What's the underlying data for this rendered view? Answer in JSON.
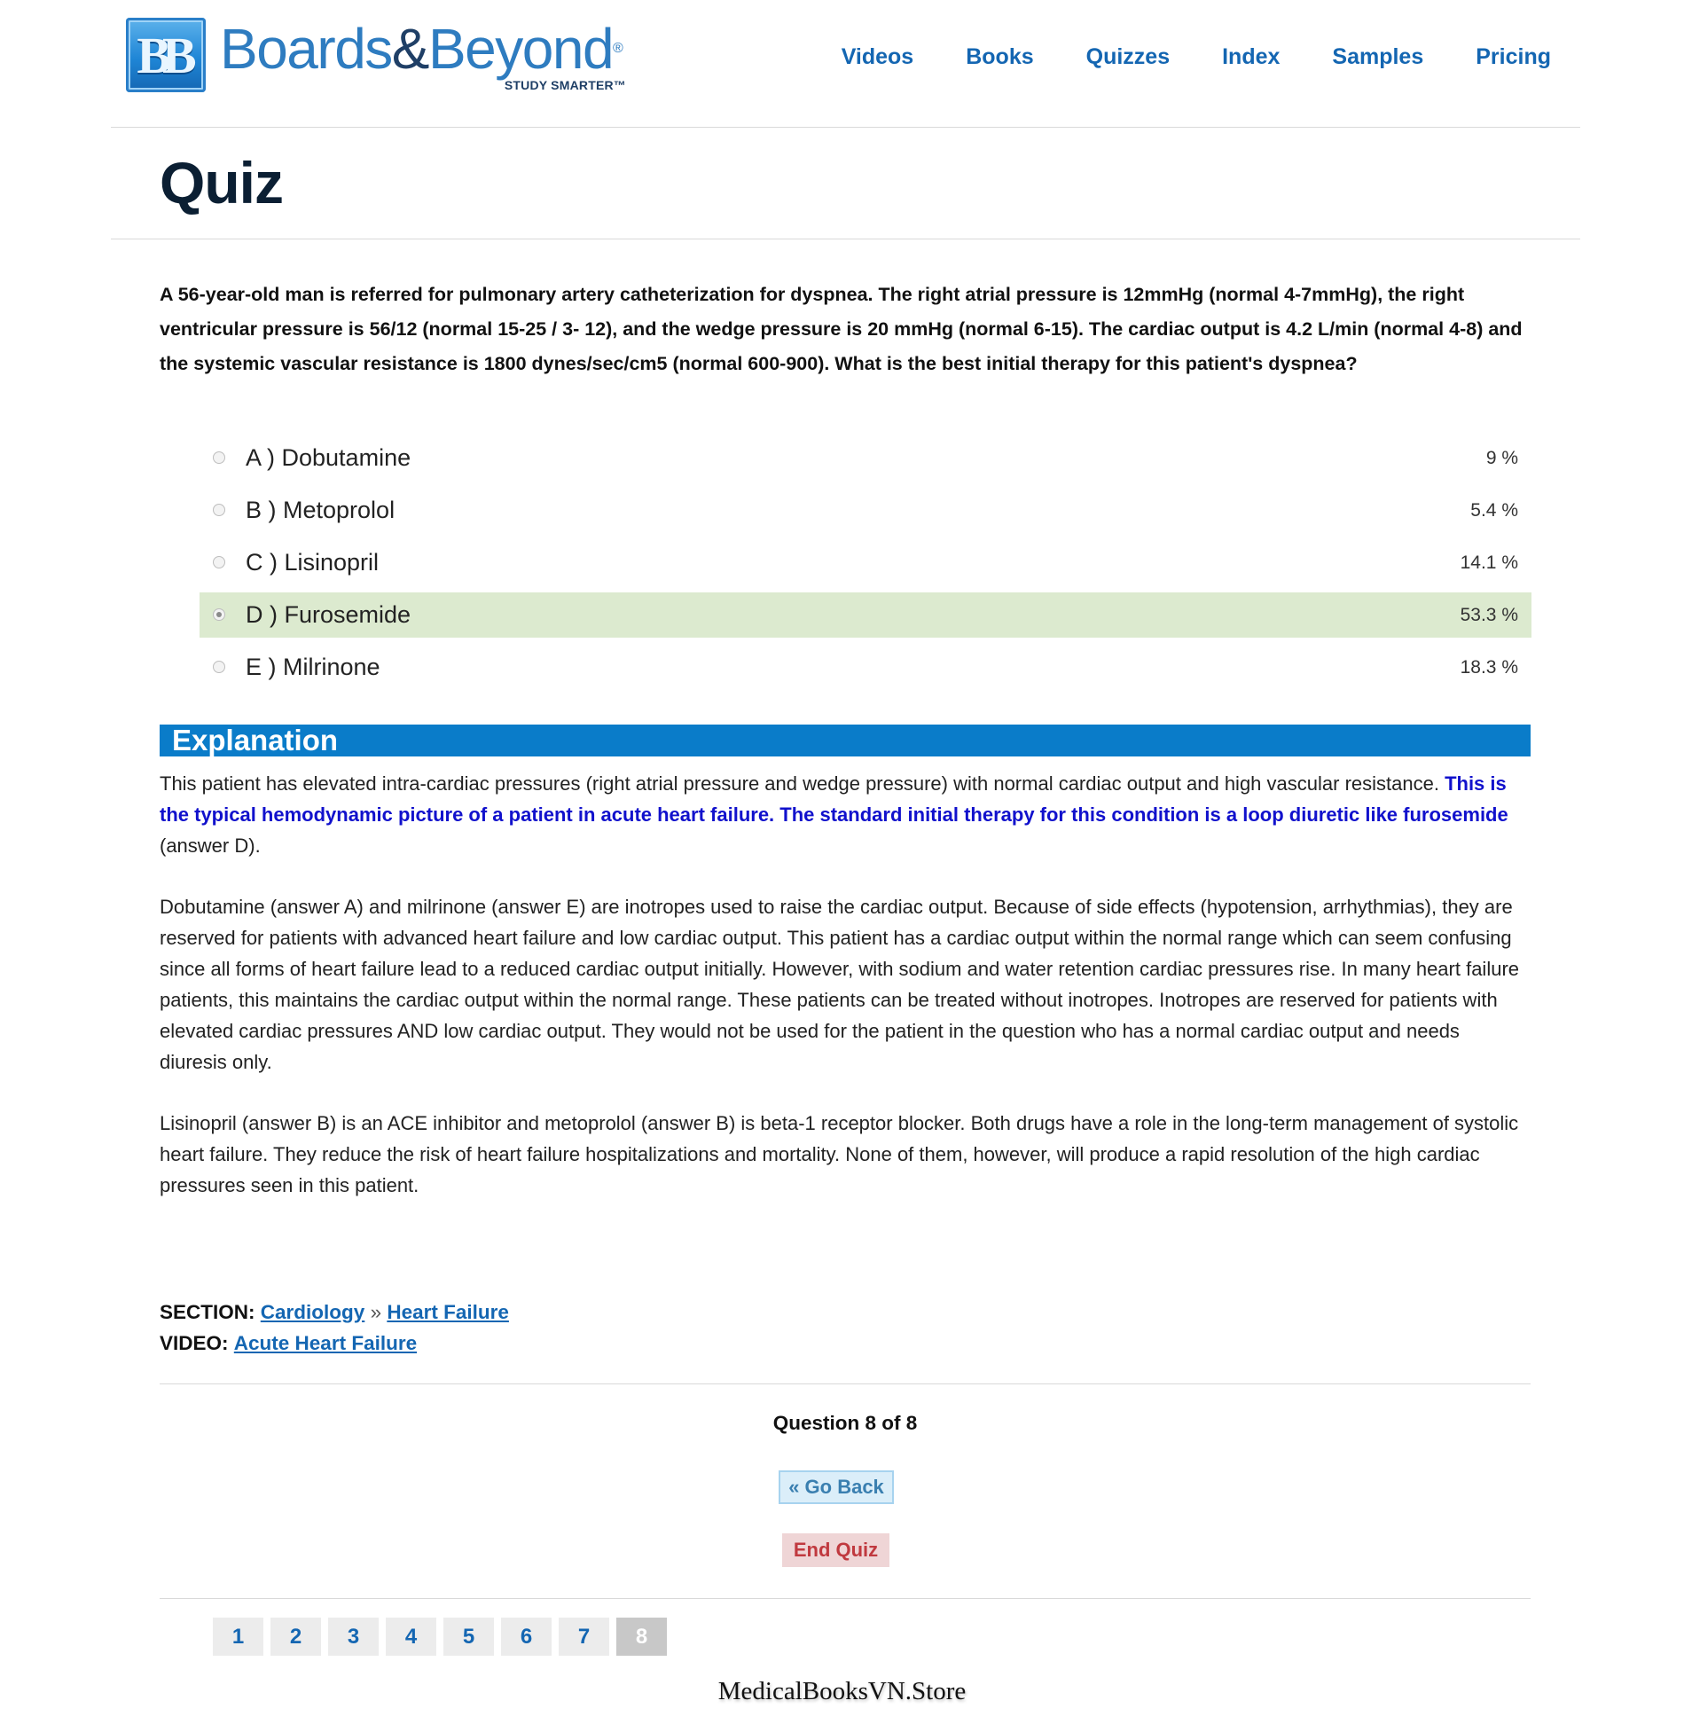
{
  "header": {
    "logo": {
      "badge": "BB",
      "word_part1": "Boards",
      "word_amp": "&",
      "word_part2": "Beyond",
      "reg_mark": "®",
      "tagline": "STUDY SMARTER™"
    },
    "nav": [
      "Videos",
      "Books",
      "Quizzes",
      "Index",
      "Samples",
      "Pricing"
    ]
  },
  "page_title": "Quiz",
  "question": "A 56-year-old man is referred for pulmonary artery catheterization for dyspnea. The right atrial pressure is 12mmHg (normal 4-7mmHg), the right ventricular pressure is 56/12 (normal 15-25 / 3- 12), and the wedge pressure is 20 mmHg (normal 6-15). The cardiac output is 4.2 L/min (normal 4-8) and the systemic vascular resistance is 1800 dynes/sec/cm5 (normal 600-900). What is the best initial therapy for this patient's dyspnea?",
  "answers": [
    {
      "label": "A ) Dobutamine",
      "percent": "9 %",
      "selected": false
    },
    {
      "label": "B ) Metoprolol",
      "percent": "5.4 %",
      "selected": false
    },
    {
      "label": "C ) Lisinopril",
      "percent": "14.1 %",
      "selected": false
    },
    {
      "label": "D ) Furosemide",
      "percent": "53.3 %",
      "selected": true
    },
    {
      "label": "E ) Milrinone",
      "percent": "18.3 %",
      "selected": false
    }
  ],
  "explanation": {
    "heading": "Explanation",
    "p1_plain": "This patient has elevated intra-cardiac pressures (right atrial pressure and wedge pressure) with normal cardiac output and high vascular resistance. ",
    "p1_highlight": "This is the typical hemodynamic picture of a patient in acute heart failure.  The standard initial therapy for this condition is a loop diuretic like furosemide",
    "p1_tail": " (answer D).",
    "p2": "Dobutamine (answer A) and milrinone (answer E) are inotropes used to raise the cardiac output. Because of side effects (hypotension, arrhythmias), they are reserved for patients with advanced heart failure and low cardiac output. This patient has a cardiac output within the normal range which can seem confusing since all forms of heart failure lead to a reduced cardiac output initially. However, with sodium and water retention cardiac pressures rise. In many heart failure patients, this maintains the cardiac output within the normal range. These patients can be treated without inotropes. Inotropes are reserved for patients with elevated cardiac pressures AND low cardiac output. They would not be used for the patient in the question who has a normal cardiac output and needs diuresis only.",
    "p3": "Lisinopril (answer B) is an ACE inhibitor and metoprolol (answer B) is beta-1 receptor blocker. Both drugs have a role in the long-term management of systolic heart failure. They reduce the risk of heart failure hospitalizations and mortality. None of them, however, will produce a rapid resolution of the high cardiac pressures seen in this patient."
  },
  "meta": {
    "section_label": "SECTION:",
    "section_link1": "Cardiology",
    "section_sep": "»",
    "section_link2": "Heart Failure",
    "video_label": "VIDEO:",
    "video_link": "Acute Heart Failure"
  },
  "footer_nav": {
    "question_count": "Question 8 of 8",
    "go_back": "« Go Back",
    "end_quiz": "End Quiz",
    "pages": [
      "1",
      "2",
      "3",
      "4",
      "5",
      "6",
      "7",
      "8"
    ],
    "current_page": "8"
  },
  "watermark": "MedicalBooksVN.Store",
  "colors": {
    "brand_blue": "#1466b2",
    "explanation_bar": "#0a7cc9",
    "selected_answer_bg": "#dceacf",
    "highlight_text": "#1111cc",
    "end_quiz_text": "#c0393f"
  }
}
